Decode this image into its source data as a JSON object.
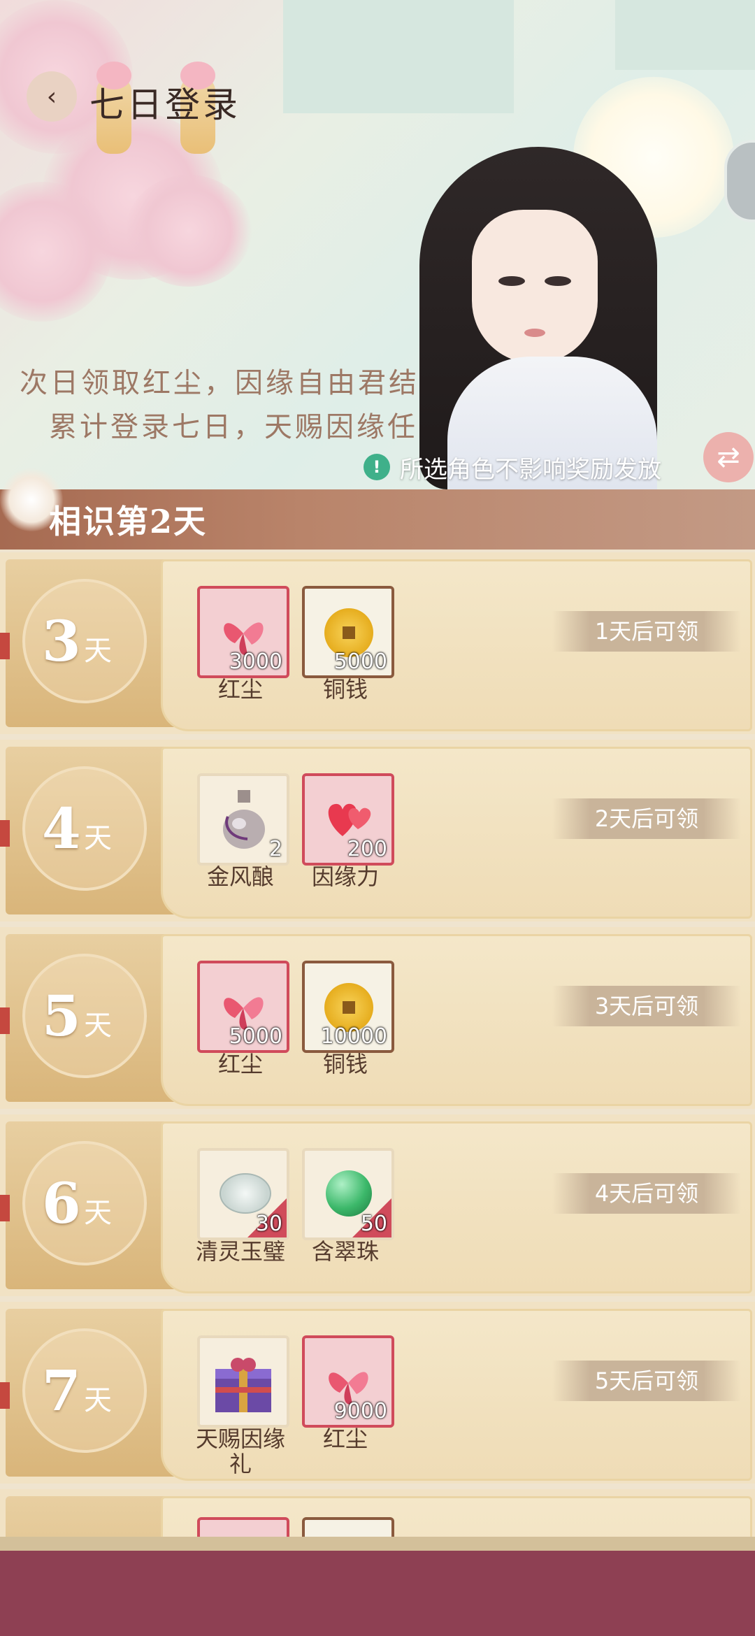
{
  "header": {
    "title": "七日登录",
    "poem_line1": "次日领取红尘，因缘自由君结",
    "poem_line2": "累计登录七日，天赐因缘任选",
    "notice": "所选角色不影响奖励发放"
  },
  "section": {
    "day_title": "相识第2天"
  },
  "rows": [
    {
      "day": "3",
      "unit": "天",
      "status": "1天后可领",
      "items": [
        {
          "name": "红尘",
          "qty": "3000",
          "icon": "butterfly-icon"
        },
        {
          "name": "铜钱",
          "qty": "5000",
          "icon": "coin-icon"
        }
      ]
    },
    {
      "day": "4",
      "unit": "天",
      "status": "2天后可领",
      "items": [
        {
          "name": "金风酿",
          "qty": "2",
          "icon": "wine-jar-icon"
        },
        {
          "name": "因缘力",
          "qty": "200",
          "icon": "heart-icon"
        }
      ]
    },
    {
      "day": "5",
      "unit": "天",
      "status": "3天后可领",
      "items": [
        {
          "name": "红尘",
          "qty": "5000",
          "icon": "butterfly-icon"
        },
        {
          "name": "铜钱",
          "qty": "10000",
          "icon": "coin-icon"
        }
      ]
    },
    {
      "day": "6",
      "unit": "天",
      "status": "4天后可领",
      "items": [
        {
          "name": "清灵玉璧",
          "qty": "30",
          "icon": "jade-disc-icon"
        },
        {
          "name": "含翠珠",
          "qty": "50",
          "icon": "green-pearl-icon"
        }
      ]
    },
    {
      "day": "7",
      "unit": "天",
      "status": "5天后可领",
      "items": [
        {
          "name": "天赐因缘礼",
          "qty": "",
          "icon": "gift-box-icon"
        },
        {
          "name": "红尘",
          "qty": "9000",
          "icon": "butterfly-icon"
        }
      ]
    }
  ],
  "colors": {
    "accent": "#d04b5b",
    "header_band": "#a66a51",
    "footer": "#8e4053",
    "status_bg": "#c9b49a"
  }
}
